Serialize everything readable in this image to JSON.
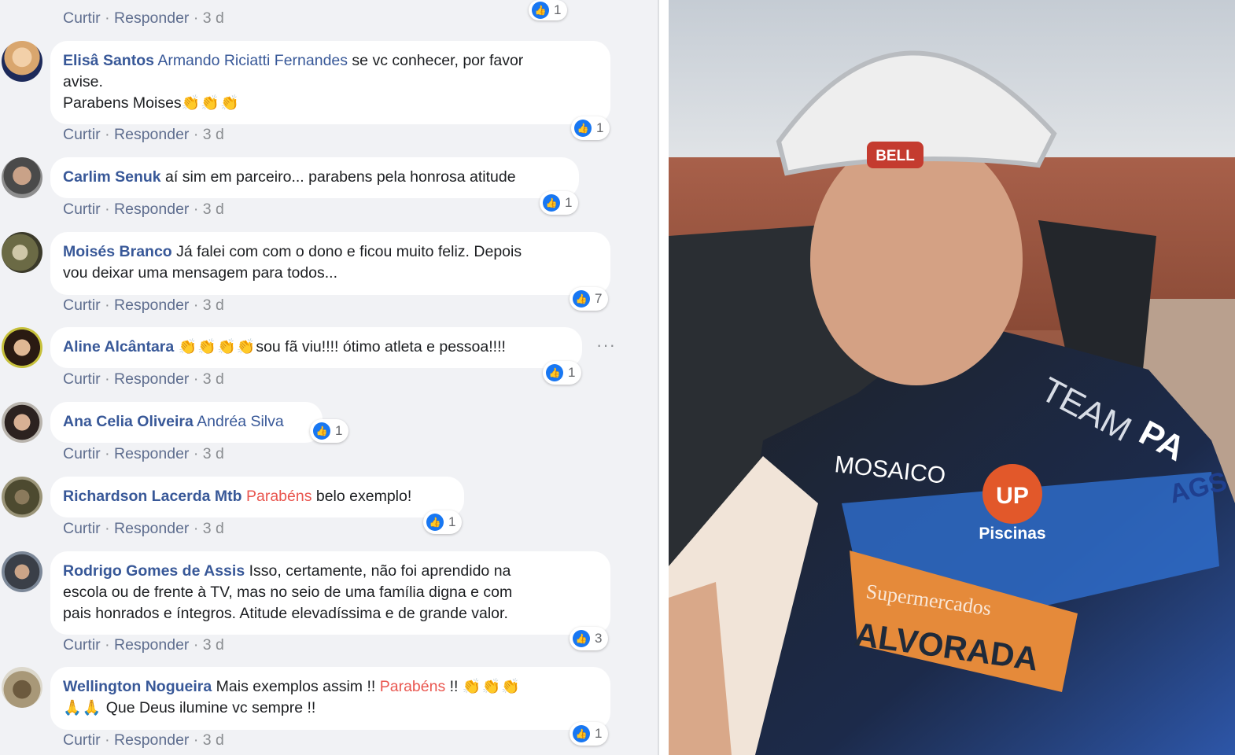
{
  "actions": {
    "like": "Curtir",
    "reply": "Responder",
    "sep": "·",
    "time": "3 d"
  },
  "top_reaction_count": "1",
  "comments": [
    {
      "author": "Elisâ Santos",
      "tag": "Armando Riciatti Fernandes",
      "text1": " se vc conhecer, por favor",
      "text2": "avise.",
      "text3": "Parabens Moises",
      "emoji": "👏👏👏",
      "reactions": "1"
    },
    {
      "author": "Carlim Senuk",
      "text": " aí sim em parceiro... parabens pela honrosa atitude",
      "reactions": "1"
    },
    {
      "author": "Moisés Branco",
      "text1": " Já falei com com o dono e ficou muito feliz. Depois",
      "text2": "vou deixar uma mensagem para todos...",
      "reactions": "7"
    },
    {
      "author": "Aline Alcântara",
      "emoji": "👏👏👏👏",
      "text": "sou fã viu!!!! ótimo atleta e pessoa!!!!",
      "reactions": "1",
      "more": "···"
    },
    {
      "author": "Ana Celia Oliveira",
      "tag": "Andréa Silva",
      "reactions": "1"
    },
    {
      "author": "Richardson Lacerda Mtb",
      "hl": "Parabéns",
      "text": " belo exemplo!",
      "reactions": "1"
    },
    {
      "author": "Rodrigo Gomes de Assis",
      "text1": " Isso, certamente, não foi aprendido na",
      "text2": "escola ou de frente à TV, mas no seio de uma família digna e com",
      "text3": "pais honrados e íntegros. Atitude elevadíssima e de grande valor.",
      "reactions": "3"
    },
    {
      "author": "Wellington Nogueira",
      "text1": " Mais exemplos assim !! ",
      "hl": "Parabéns",
      "text1b": " !! ",
      "emoji1": "👏👏👏",
      "emoji2": "🙏🙏",
      "text2": " Que Deus ilumine vc sempre !!",
      "reactions": "1"
    }
  ],
  "photo": {
    "helmet_brand": "BELL",
    "jersey_team": "TEAM",
    "jersey_pa": "PA",
    "sponsor_up": "UP",
    "sponsor_piscinas": "Piscinas",
    "sponsor_alvorada": "ALVORADA",
    "sponsor_mercados": "Supermercados",
    "sponsor_ags": "AGS",
    "sponsor_mosaico": "MOSAICO"
  },
  "colors": {
    "link": "#385898",
    "highlight": "#e9564f",
    "like": "#1877f2",
    "panel_bg": "#f1f2f5"
  }
}
